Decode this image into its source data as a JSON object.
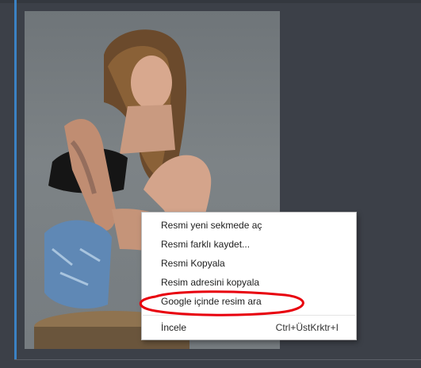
{
  "context_menu": {
    "items": [
      {
        "label": "Resmi yeni sekmede aç"
      },
      {
        "label": "Resmi farklı kaydet..."
      },
      {
        "label": "Resmi Kopyala"
      },
      {
        "label": "Resim adresini kopyala"
      },
      {
        "label": "Google içinde resim ara"
      }
    ],
    "inspect": {
      "label": "İncele",
      "shortcut": "Ctrl+ÜstKrktr+I"
    }
  },
  "colors": {
    "background": "#3c4048",
    "accent": "#3b82c4",
    "annotation": "#e8000d"
  }
}
